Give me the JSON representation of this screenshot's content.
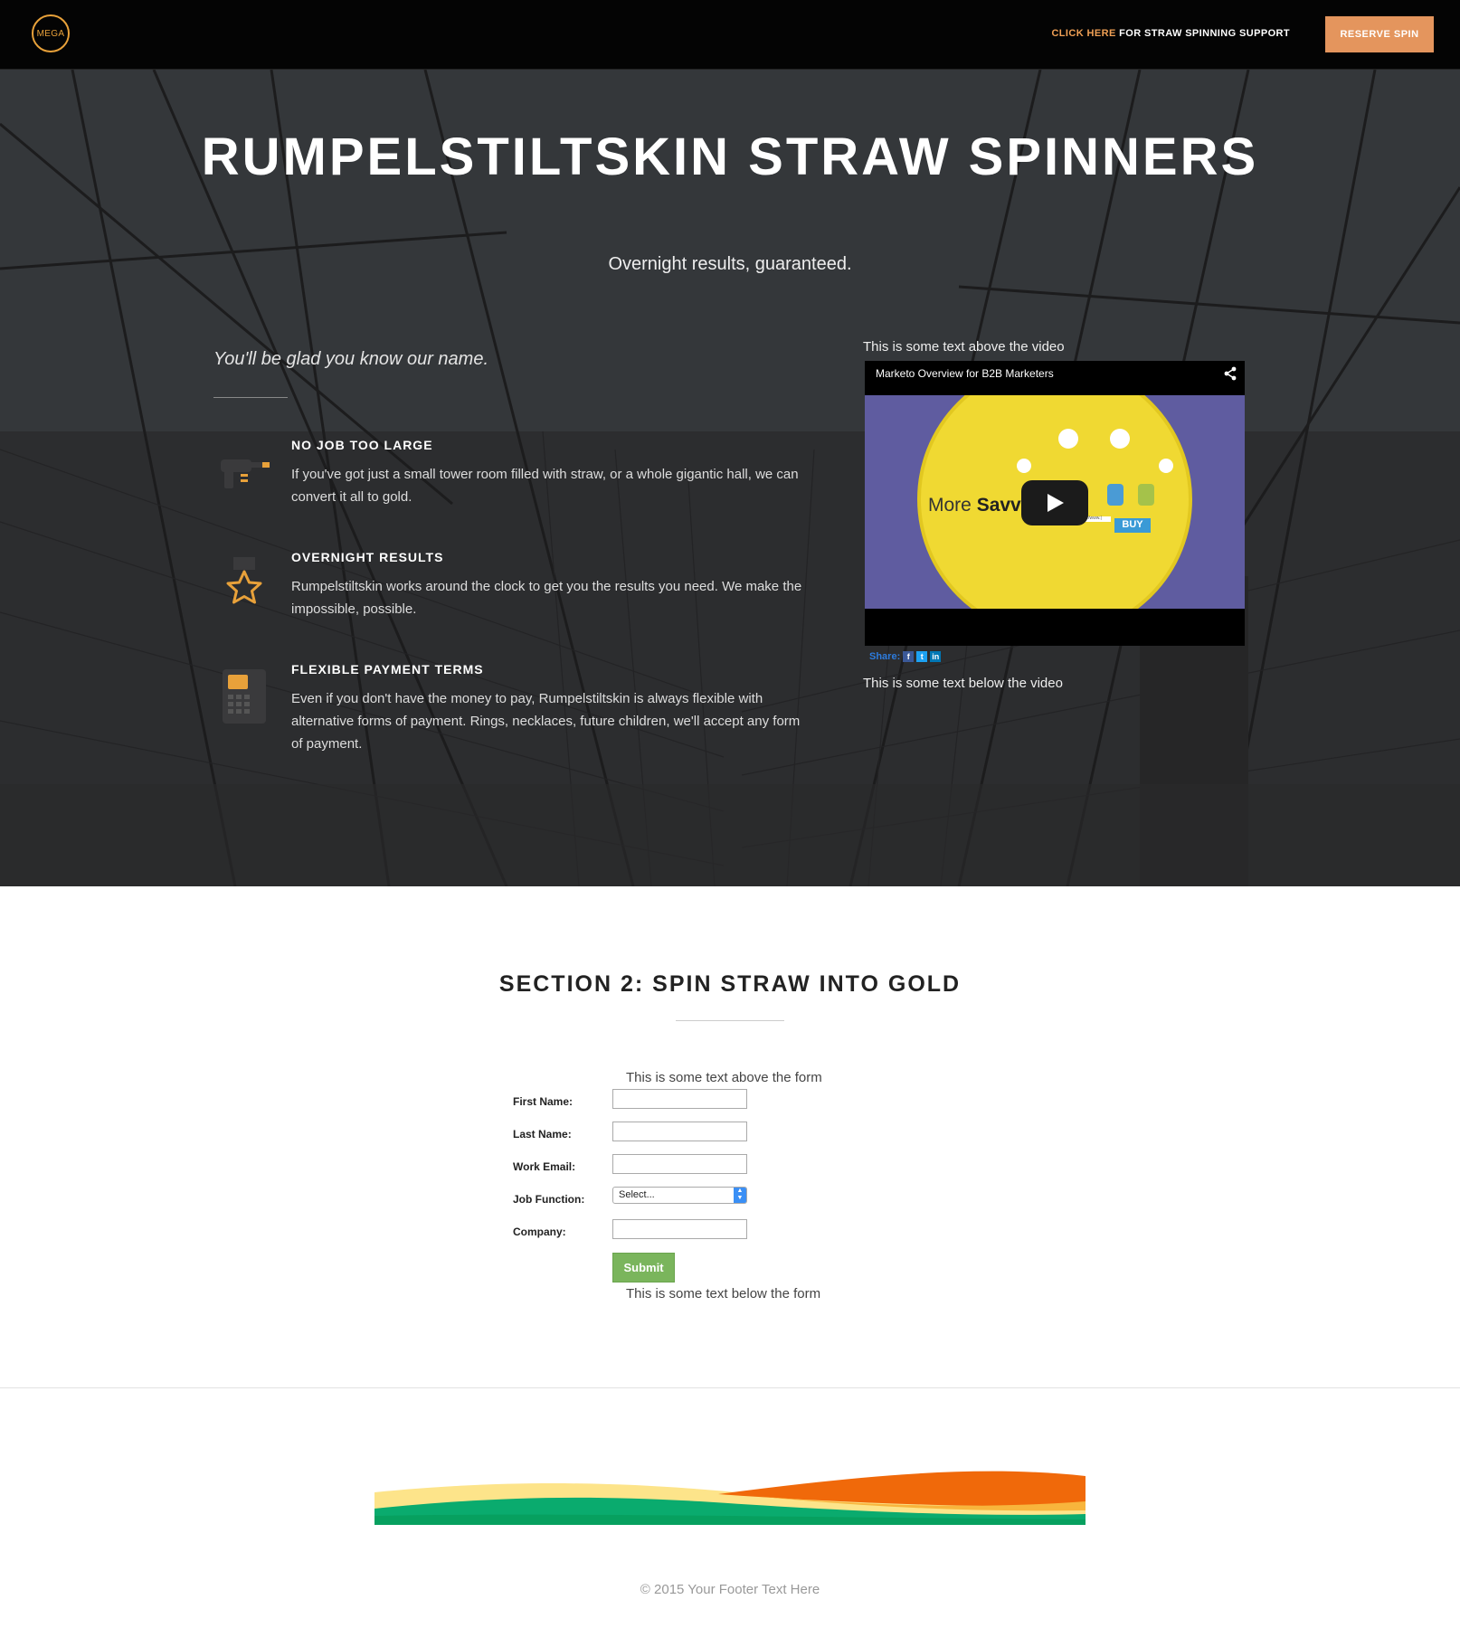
{
  "header": {
    "logo_text": "MEGA",
    "support_highlight": "CLICK HERE",
    "support_rest": " FOR STRAW SPINNING SUPPORT",
    "reserve_label": "RESERVE SPIN",
    "accent_color": "#e4955d"
  },
  "hero": {
    "title": "RUMPELSTILTSKIN STRAW SPINNERS",
    "subtitle": "Overnight results, guaranteed.",
    "tagline": "You'll be glad you know our name.",
    "features": [
      {
        "icon": "blaster-icon",
        "title": "NO JOB TOO LARGE",
        "text": "If you've got just a small tower room filled with straw, or a whole gigantic hall, we can convert it all to gold."
      },
      {
        "icon": "trophy-star-icon",
        "title": "OVERNIGHT RESULTS",
        "text": "Rumpelstiltskin works around the clock to get you the results you need. We make the impossible, possible."
      },
      {
        "icon": "payment-terminal-icon",
        "title": "FLEXIBLE PAYMENT TERMS",
        "text": "Even if you don't have the money to pay, Rumpelstiltskin is always flexible with alternative forms of payment. Rings, necklaces, future children, we'll accept any form of payment."
      }
    ],
    "video": {
      "text_above": "This is some text above the video",
      "title": "Marketo Overview for B2B Marketers",
      "thumb_text_light": "More ",
      "thumb_text_bold": "Savvy",
      "thumb_buy": "BUY",
      "thumb_url": "http://www.|",
      "share_label": "Share:",
      "share_icons": [
        "facebook-icon",
        "twitter-icon",
        "linkedin-icon"
      ],
      "text_below": "This is some text below the video"
    }
  },
  "section2": {
    "title": "SECTION 2: SPIN STRAW INTO GOLD",
    "text_above_form": "This is some text above the form",
    "fields": [
      {
        "label": "First Name:",
        "value": ""
      },
      {
        "label": "Last Name:",
        "value": ""
      },
      {
        "label": "Work Email:",
        "value": ""
      },
      {
        "label": "Job Function:",
        "value": "Select..."
      },
      {
        "label": "Company:",
        "value": ""
      }
    ],
    "submit_label": "Submit",
    "text_below_form": "This is some text below the form"
  },
  "footer": {
    "text": "© 2015 Your Footer Text Here"
  }
}
